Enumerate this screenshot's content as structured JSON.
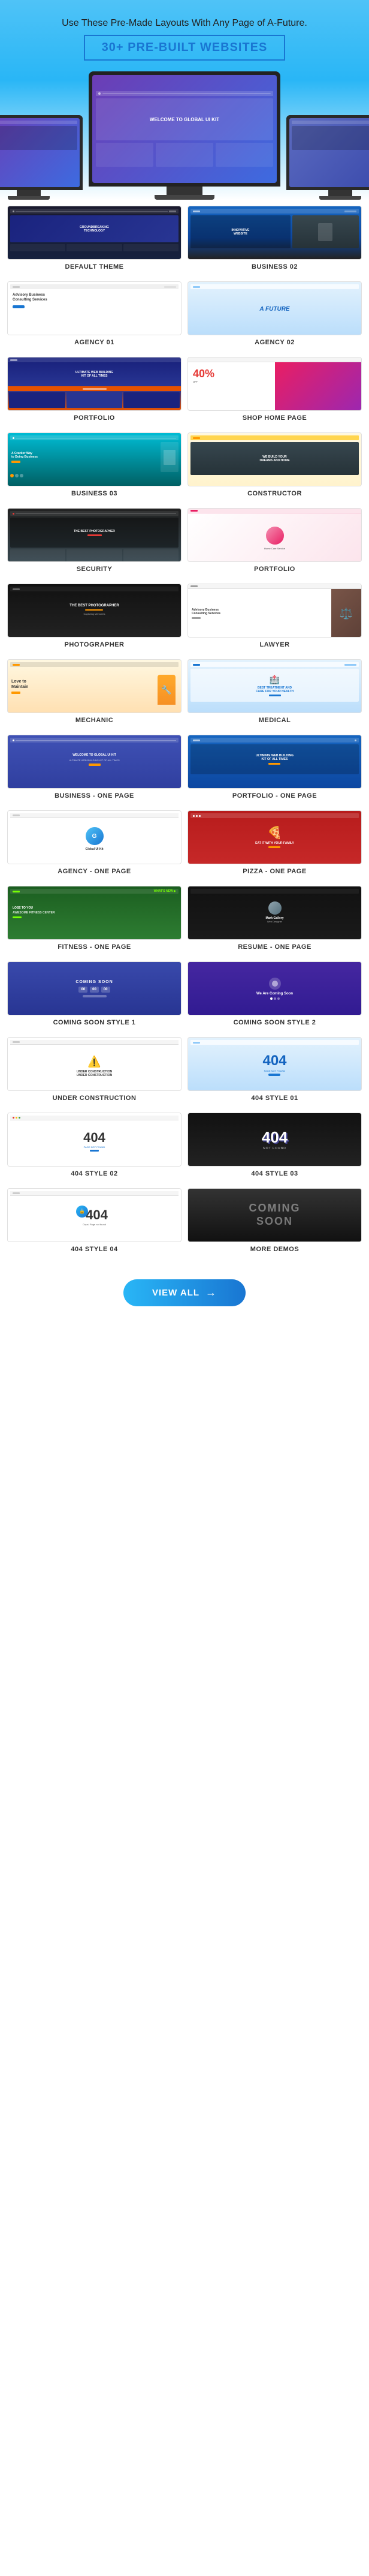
{
  "header": {
    "tagline": "Use These Pre-Made Layouts With Any Page of A-Future.",
    "badge": "30+ PRE-BUILT WEBSITES",
    "monitor_screen_text": "WELCOME TO GLOBAL UI KIT"
  },
  "grid": {
    "rows": [
      [
        {
          "id": "default-theme",
          "label": "DEFAULT THEME",
          "theme": "t-default"
        },
        {
          "id": "business-02",
          "label": "BUSINESS 02",
          "theme": "t-business02"
        }
      ],
      [
        {
          "id": "agency-01",
          "label": "AGENCY 01",
          "theme": "t-agency01"
        },
        {
          "id": "agency-02",
          "label": "AGENCY 02",
          "theme": "t-agency02"
        }
      ],
      [
        {
          "id": "portfolio",
          "label": "PORTFOLIO",
          "theme": "t-portfolio"
        },
        {
          "id": "shop-home-page",
          "label": "SHOP HOME PAGE",
          "theme": "t-shop"
        }
      ],
      [
        {
          "id": "business-03",
          "label": "BUSINESS 03",
          "theme": "t-business03"
        },
        {
          "id": "constructor",
          "label": "CONSTRUCTOR",
          "theme": "t-constructor"
        }
      ],
      [
        {
          "id": "security",
          "label": "SECURITY",
          "theme": "t-security"
        },
        {
          "id": "portfolio-2",
          "label": "PORTFOLIO",
          "theme": "t-portfolio2"
        }
      ],
      [
        {
          "id": "photographer",
          "label": "PHOTOGRAPHER",
          "theme": "t-photographer"
        },
        {
          "id": "lawyer",
          "label": "LAWYER",
          "theme": "t-lawyer"
        }
      ],
      [
        {
          "id": "mechanic",
          "label": "MECHANIC",
          "theme": "t-mechanic"
        },
        {
          "id": "medical",
          "label": "MEDICAL",
          "theme": "t-medical"
        }
      ],
      [
        {
          "id": "business-one-page",
          "label": "BUSINESS - ONE PAGE",
          "theme": "t-business1p"
        },
        {
          "id": "portfolio-one-page",
          "label": "PORTFOLIO - ONE PAGE",
          "theme": "t-portfolio1p"
        }
      ],
      [
        {
          "id": "agency-one-page",
          "label": "AGENCY - ONE PAGE",
          "theme": "t-agency1p"
        },
        {
          "id": "pizza-one-page",
          "label": "PIZZA - ONE PAGE",
          "theme": "t-pizza"
        }
      ],
      [
        {
          "id": "fitness-one-page",
          "label": "FITNESS - ONE PAGE",
          "theme": "t-fitness"
        },
        {
          "id": "resume-one-page",
          "label": "RESUME - ONE PAGE",
          "theme": "t-resume"
        }
      ],
      [
        {
          "id": "coming-soon-1",
          "label": "COMING SOON STYLE 1",
          "theme": "t-coming1"
        },
        {
          "id": "coming-soon-2",
          "label": "COMING SOON STYLE 2",
          "theme": "t-coming2"
        }
      ],
      [
        {
          "id": "under-construction",
          "label": "UNDER CONSTRUCTION",
          "theme": "t-underconstruction"
        },
        {
          "id": "404-style-01",
          "label": "404 STYLE 01",
          "theme": "t-404s1"
        }
      ],
      [
        {
          "id": "404-style-02",
          "label": "404 STYLE 02",
          "theme": "t-404s2"
        },
        {
          "id": "404-style-03",
          "label": "404 STYLE 03",
          "theme": "t-404s3"
        }
      ],
      [
        {
          "id": "404-style-04",
          "label": "404 STYLE 04",
          "theme": "t-404s4"
        },
        {
          "id": "more-demos",
          "label": "MORE DEMOS",
          "theme": "t-moredemos"
        }
      ]
    ]
  },
  "footer": {
    "view_all_label": "VIEW ALL",
    "arrow": "→"
  }
}
